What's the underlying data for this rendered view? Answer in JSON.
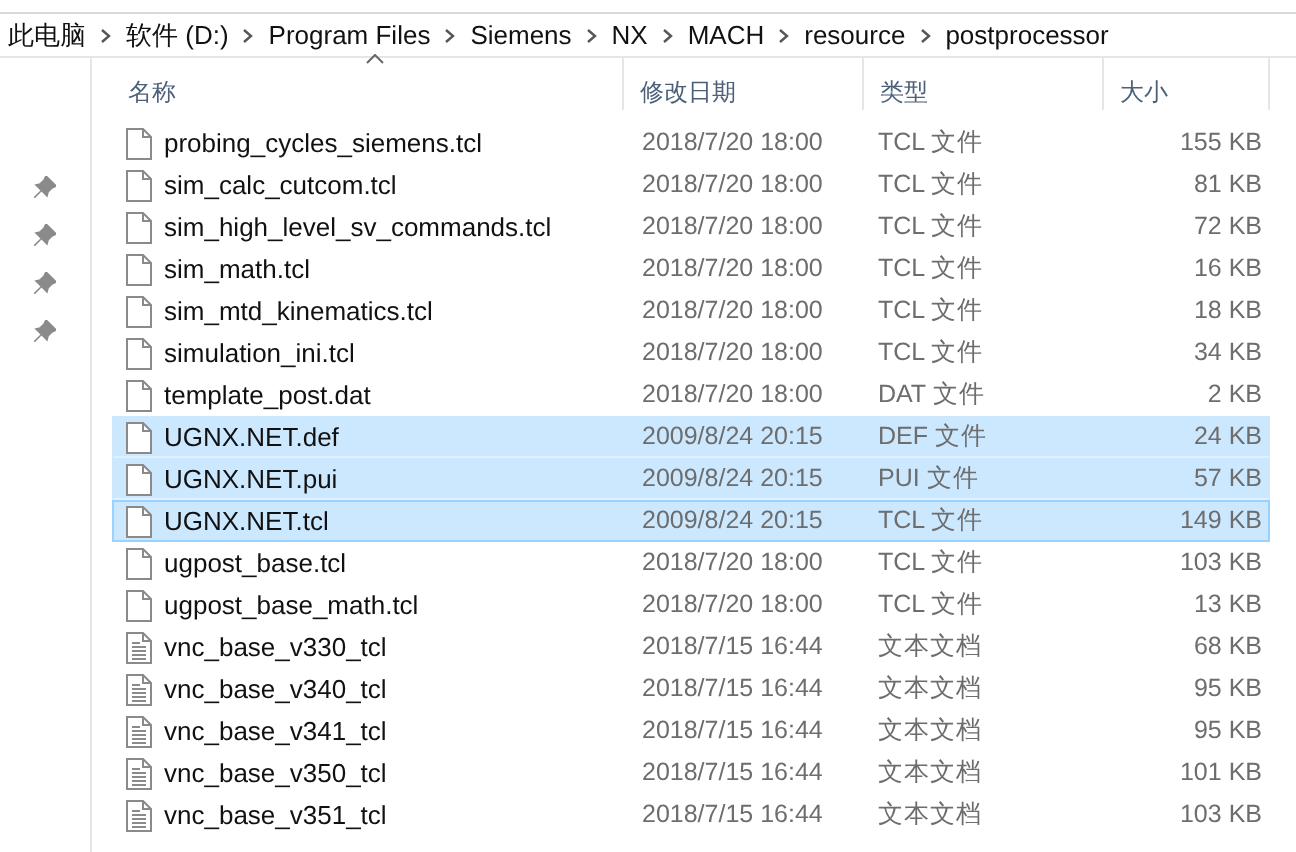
{
  "breadcrumb": [
    "此电脑",
    "软件 (D:)",
    "Program Files",
    "Siemens",
    "NX",
    "MACH",
    "resource",
    "postprocessor"
  ],
  "nav_pins": [
    {
      "pinned": true
    },
    {
      "pinned": true
    },
    {
      "pinned": true
    },
    {
      "pinned": true
    }
  ],
  "columns": [
    {
      "label": "名称",
      "sorted": true
    },
    {
      "label": "修改日期",
      "sorted": false
    },
    {
      "label": "类型",
      "sorted": false
    },
    {
      "label": "大小",
      "sorted": false
    }
  ],
  "rows": [
    {
      "name": "probing_cycles_siemens.tcl",
      "date": "2018/7/20 18:00",
      "type": "TCL 文件",
      "size": "155 KB",
      "kind": "file",
      "selected": false,
      "focused": false
    },
    {
      "name": "sim_calc_cutcom.tcl",
      "date": "2018/7/20 18:00",
      "type": "TCL 文件",
      "size": "81 KB",
      "kind": "file",
      "selected": false,
      "focused": false
    },
    {
      "name": "sim_high_level_sv_commands.tcl",
      "date": "2018/7/20 18:00",
      "type": "TCL 文件",
      "size": "72 KB",
      "kind": "file",
      "selected": false,
      "focused": false
    },
    {
      "name": "sim_math.tcl",
      "date": "2018/7/20 18:00",
      "type": "TCL 文件",
      "size": "16 KB",
      "kind": "file",
      "selected": false,
      "focused": false
    },
    {
      "name": "sim_mtd_kinematics.tcl",
      "date": "2018/7/20 18:00",
      "type": "TCL 文件",
      "size": "18 KB",
      "kind": "file",
      "selected": false,
      "focused": false
    },
    {
      "name": "simulation_ini.tcl",
      "date": "2018/7/20 18:00",
      "type": "TCL 文件",
      "size": "34 KB",
      "kind": "file",
      "selected": false,
      "focused": false
    },
    {
      "name": "template_post.dat",
      "date": "2018/7/20 18:00",
      "type": "DAT 文件",
      "size": "2 KB",
      "kind": "file",
      "selected": false,
      "focused": false
    },
    {
      "name": "UGNX.NET.def",
      "date": "2009/8/24 20:15",
      "type": "DEF 文件",
      "size": "24 KB",
      "kind": "file",
      "selected": true,
      "focused": false
    },
    {
      "name": "UGNX.NET.pui",
      "date": "2009/8/24 20:15",
      "type": "PUI 文件",
      "size": "57 KB",
      "kind": "file",
      "selected": true,
      "focused": false
    },
    {
      "name": "UGNX.NET.tcl",
      "date": "2009/8/24 20:15",
      "type": "TCL 文件",
      "size": "149 KB",
      "kind": "file",
      "selected": true,
      "focused": true
    },
    {
      "name": "ugpost_base.tcl",
      "date": "2018/7/20 18:00",
      "type": "TCL 文件",
      "size": "103 KB",
      "kind": "file",
      "selected": false,
      "focused": false
    },
    {
      "name": "ugpost_base_math.tcl",
      "date": "2018/7/20 18:00",
      "type": "TCL 文件",
      "size": "13 KB",
      "kind": "file",
      "selected": false,
      "focused": false
    },
    {
      "name": "vnc_base_v330_tcl",
      "date": "2018/7/15 16:44",
      "type": "文本文档",
      "size": "68 KB",
      "kind": "text",
      "selected": false,
      "focused": false
    },
    {
      "name": "vnc_base_v340_tcl",
      "date": "2018/7/15 16:44",
      "type": "文本文档",
      "size": "95 KB",
      "kind": "text",
      "selected": false,
      "focused": false
    },
    {
      "name": "vnc_base_v341_tcl",
      "date": "2018/7/15 16:44",
      "type": "文本文档",
      "size": "95 KB",
      "kind": "text",
      "selected": false,
      "focused": false
    },
    {
      "name": "vnc_base_v350_tcl",
      "date": "2018/7/15 16:44",
      "type": "文本文档",
      "size": "101 KB",
      "kind": "text",
      "selected": false,
      "focused": false
    },
    {
      "name": "vnc_base_v351_tcl",
      "date": "2018/7/15 16:44",
      "type": "文本文档",
      "size": "103 KB",
      "kind": "text",
      "selected": false,
      "focused": false
    }
  ]
}
